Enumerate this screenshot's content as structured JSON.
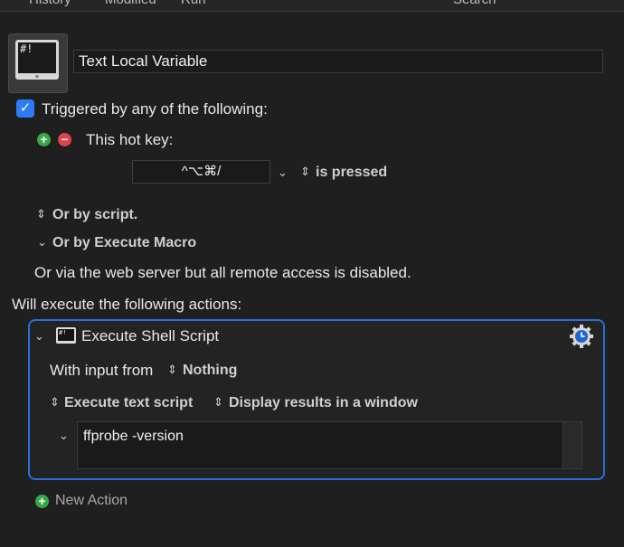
{
  "toolbar": {
    "history": "History",
    "modified": "Modified",
    "run": "Run",
    "search": "Search"
  },
  "macro": {
    "icon_text": "#!",
    "title": "Text Local Variable"
  },
  "trigger": {
    "checkbox_checked": true,
    "label": "Triggered by any of the following:",
    "hotkey_label": "This hot key:",
    "hotkey_value": "^⌥⌘/",
    "pressed_label": "is pressed",
    "by_script": "Or by script.",
    "by_execute_macro": "Or by Execute Macro",
    "web_server": "Or via the web server but all remote access is disabled."
  },
  "actions": {
    "heading": "Will execute the following actions:",
    "items": [
      {
        "title": "Execute Shell Script",
        "icon_text": "#!",
        "input_label": "With input from",
        "input_value": "Nothing",
        "mode": "Execute text script",
        "output": "Display results in a window",
        "script": "ffprobe -version"
      }
    ],
    "new_action": "New Action"
  },
  "colors": {
    "accent": "#2a6fd8",
    "checkbox": "#2d7cf6",
    "plus": "#36a845",
    "minus": "#e0424a"
  }
}
